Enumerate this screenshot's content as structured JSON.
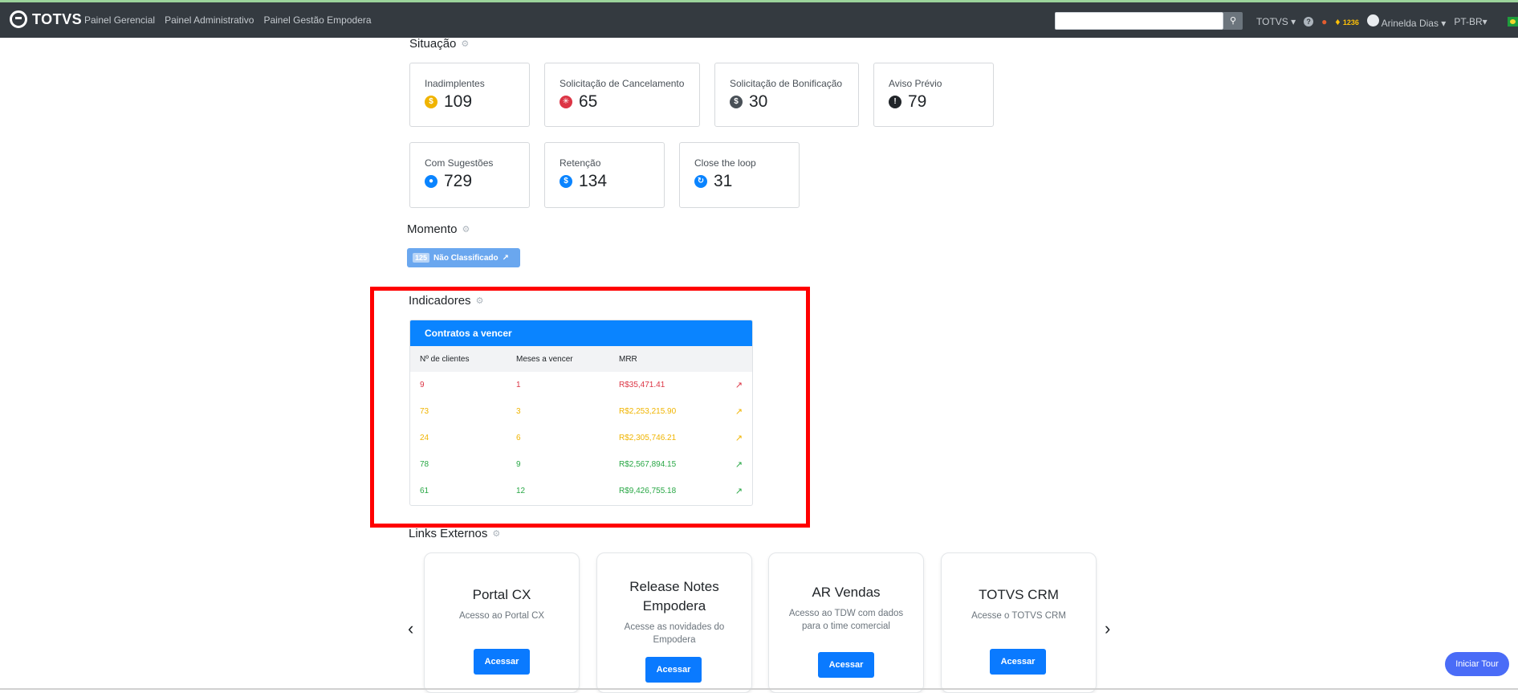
{
  "nav": {
    "brand": "TOTVS",
    "links": [
      "Painel Gerencial",
      "Painel Administrativo",
      "Painel Gestão Empodera"
    ],
    "search_placeholder": "",
    "totvs_menu": "TOTVS",
    "notification_count": "1236",
    "user_name": "Arinelda Dias",
    "language": "PT-BR"
  },
  "situacao": {
    "title": "Situação",
    "cards": [
      {
        "label": "Inadimplentes",
        "value": "109",
        "icon": "search-dollar-icon",
        "color": "#f0b400"
      },
      {
        "label": "Solicitação de Cancelamento",
        "value": "65",
        "icon": "bomb-icon",
        "color": "#dc3545"
      },
      {
        "label": "Solicitação de Bonificação",
        "value": "30",
        "icon": "comment-dollar-icon",
        "color": "#495057"
      },
      {
        "label": "Aviso Prévio",
        "value": "79",
        "icon": "exclamation-circle-icon",
        "color": "#212529"
      },
      {
        "label": "Com Sugestões",
        "value": "729",
        "icon": "lightbulb-icon",
        "color": "#0a84ff"
      },
      {
        "label": "Retenção",
        "value": "134",
        "icon": "hand-holding-dollar-icon",
        "color": "#0a84ff"
      },
      {
        "label": "Close the loop",
        "value": "31",
        "icon": "sync-icon",
        "color": "#0a84ff"
      }
    ]
  },
  "momento": {
    "title": "Momento",
    "badge_count": "125",
    "badge_label": "Não Classificado"
  },
  "indicadores": {
    "title": "Indicadores",
    "table_title": "Contratos a vencer",
    "columns": [
      "Nº de clientes",
      "Meses a vencer",
      "MRR"
    ],
    "rows": [
      {
        "clients": "9",
        "months": "1",
        "mrr": "R$35,471.41",
        "status": "red"
      },
      {
        "clients": "73",
        "months": "3",
        "mrr": "R$2,253,215.90",
        "status": "yellow"
      },
      {
        "clients": "24",
        "months": "6",
        "mrr": "R$2,305,746.21",
        "status": "yellow"
      },
      {
        "clients": "78",
        "months": "9",
        "mrr": "R$2,567,894.15",
        "status": "green"
      },
      {
        "clients": "61",
        "months": "12",
        "mrr": "R$9,426,755.18",
        "status": "green"
      }
    ]
  },
  "links_externos": {
    "title": "Links Externos",
    "cards": [
      {
        "title": "Portal CX",
        "subtitle": "Acesso ao Portal CX",
        "button": "Acessar"
      },
      {
        "title": "Release Notes Empodera",
        "subtitle": "Acesse as novidades do Empodera",
        "button": "Acessar"
      },
      {
        "title": "AR Vendas",
        "subtitle": "Acesso ao TDW com dados para o time comercial",
        "button": "Acessar"
      },
      {
        "title": "TOTVS CRM",
        "subtitle": "Acesse o TOTVS CRM",
        "button": "Acessar"
      }
    ]
  },
  "tour_button": "Iniciar Tour"
}
